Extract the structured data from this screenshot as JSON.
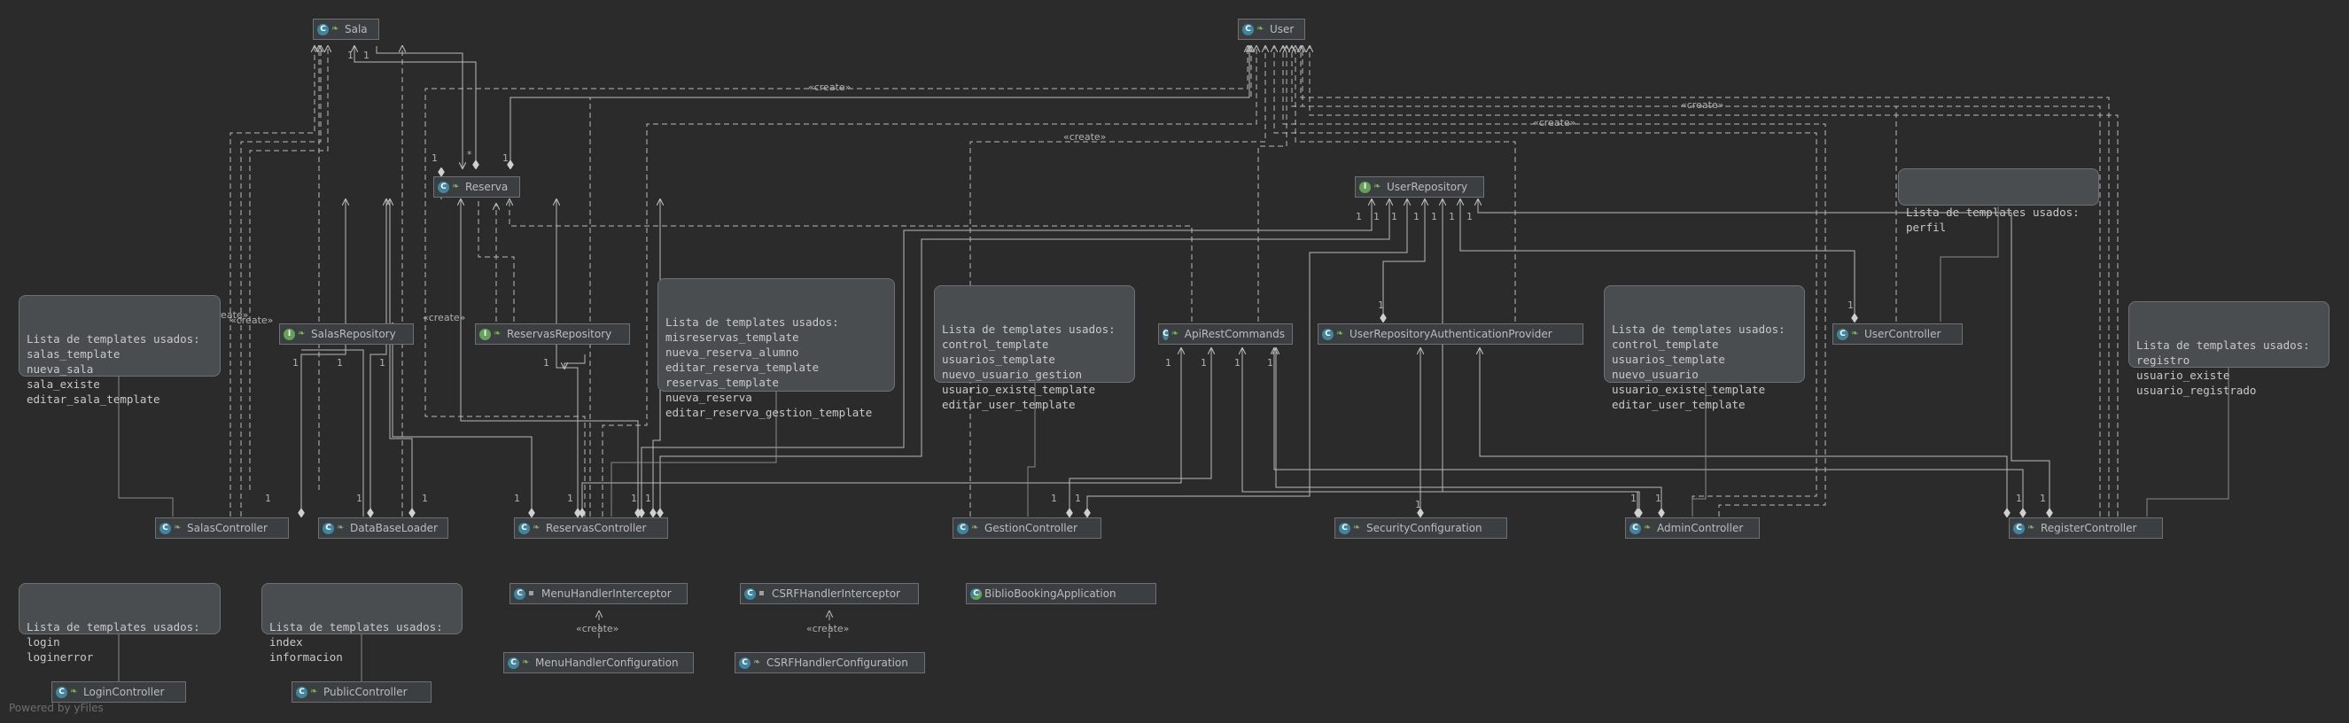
{
  "classes": {
    "sala": {
      "name": "Sala",
      "kind": "class"
    },
    "user": {
      "name": "User",
      "kind": "class"
    },
    "reserva": {
      "name": "Reserva",
      "kind": "class"
    },
    "userRepository": {
      "name": "UserRepository",
      "kind": "interface"
    },
    "salasRepository": {
      "name": "SalasRepository",
      "kind": "interface"
    },
    "reservasRepository": {
      "name": "ReservasRepository",
      "kind": "interface"
    },
    "apiRestCommands": {
      "name": "ApiRestCommands",
      "kind": "class"
    },
    "userRepoAuthProvider": {
      "name": "UserRepositoryAuthenticationProvider",
      "kind": "class"
    },
    "userController": {
      "name": "UserController",
      "kind": "class"
    },
    "salasController": {
      "name": "SalasController",
      "kind": "class"
    },
    "dataBaseLoader": {
      "name": "DataBaseLoader",
      "kind": "class"
    },
    "reservasController": {
      "name": "ReservasController",
      "kind": "class"
    },
    "gestionController": {
      "name": "GestionController",
      "kind": "class"
    },
    "securityConfiguration": {
      "name": "SecurityConfiguration",
      "kind": "class"
    },
    "adminController": {
      "name": "AdminController",
      "kind": "class"
    },
    "registerController": {
      "name": "RegisterController",
      "kind": "class"
    },
    "menuHandlerInterceptor": {
      "name": "MenuHandlerInterceptor",
      "kind": "class"
    },
    "csrfHandlerInterceptor": {
      "name": "CSRFHandlerInterceptor",
      "kind": "class"
    },
    "biblioBookingApplication": {
      "name": "BiblioBookingApplication",
      "kind": "application"
    },
    "menuHandlerConfiguration": {
      "name": "MenuHandlerConfiguration",
      "kind": "class"
    },
    "csrfHandlerConfiguration": {
      "name": "CSRFHandlerConfiguration",
      "kind": "class"
    },
    "loginController": {
      "name": "LoginController",
      "kind": "class"
    },
    "publicController": {
      "name": "PublicController",
      "kind": "class"
    }
  },
  "notes": {
    "perfil": {
      "title": "Lista de templates usados:",
      "items": [
        "perfil"
      ]
    },
    "salas": {
      "title": "Lista de templates usados:",
      "items": [
        "salas_template",
        "nueva_sala",
        "sala_existe",
        "editar_sala_template"
      ]
    },
    "reservas": {
      "title": "Lista de templates usados:",
      "items": [
        "misreservas_template",
        "nueva_reserva_alumno",
        "editar_reserva_template",
        "reservas_template",
        "nueva_reserva",
        "editar_reserva_gestion_template"
      ]
    },
    "gestion": {
      "title": "Lista de templates usados:",
      "items": [
        "control_template",
        "usuarios_template",
        "nuevo_usuario_gestion",
        "usuario_existe_template",
        "editar_user_template"
      ]
    },
    "admin": {
      "title": "Lista de templates usados:",
      "items": [
        "control_template",
        "usuarios_template",
        "nuevo_usuario",
        "usuario_existe_template",
        "editar_user_template"
      ]
    },
    "register": {
      "title": "Lista de templates usados:",
      "items": [
        "registro",
        "usuario_existe",
        "usuario_registrado"
      ]
    },
    "login": {
      "title": "Lista de templates usados:",
      "items": [
        "login",
        "loginerror"
      ]
    },
    "public": {
      "title": "Lista de templates usados:",
      "items": [
        "index",
        "informacion"
      ]
    }
  },
  "labels": {
    "create": "«create»"
  },
  "multiplicities": {
    "one": "1",
    "many": "*"
  },
  "footer": "Powered by yFiles",
  "colors": {
    "background": "#2b2b2b",
    "node_fill": "#3c3f41",
    "note_fill": "#4a4d4f",
    "edge": "#b8b8b8",
    "class_badge": "#3e86a0",
    "interface_badge": "#62a354"
  }
}
